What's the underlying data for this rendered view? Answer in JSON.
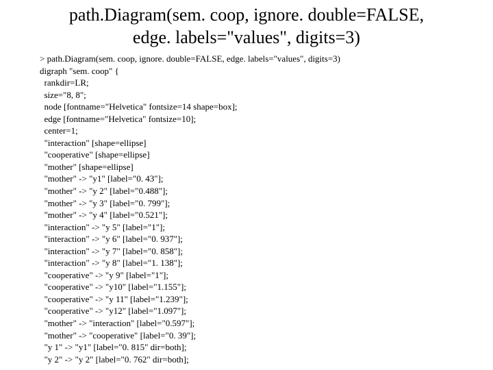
{
  "title_line1": "path.Diagram(sem. coop, ignore. double=FALSE,",
  "title_line2": "edge. labels=\"values\", digits=3)",
  "code_lines": [
    "> path.Diagram(sem. coop, ignore. double=FALSE, edge. labels=\"values\", digits=3)",
    "digraph \"sem. coop\" {",
    "  rankdir=LR;",
    "  size=\"8, 8\";",
    "  node [fontname=\"Helvetica\" fontsize=14 shape=box];",
    "  edge [fontname=\"Helvetica\" fontsize=10];",
    "  center=1;",
    "  \"interaction\" [shape=ellipse]",
    "  \"cooperative\" [shape=ellipse]",
    "  \"mother\" [shape=ellipse]",
    "  \"mother\" -> \"y1\" [label=\"0. 43\"];",
    "  \"mother\" -> \"y 2\" [label=\"0.488\"];",
    "  \"mother\" -> \"y 3\" [label=\"0. 799\"];",
    "  \"mother\" -> \"y 4\" [label=\"0.521\"];",
    "  \"interaction\" -> \"y 5\" [label=\"1\"];",
    "  \"interaction\" -> \"y 6\" [label=\"0. 937\"];",
    "  \"interaction\" -> \"y 7\" [label=\"0. 858\"];",
    "  \"interaction\" -> \"y 8\" [label=\"1. 138\"];",
    "  \"cooperative\" -> \"y 9\" [label=\"1\"];",
    "  \"cooperative\" -> \"y10\" [label=\"1.155\"];",
    "  \"cooperative\" -> \"y 11\" [label=\"1.239\"];",
    "  \"cooperative\" -> \"y12\" [label=\"1.097\"];",
    "  \"mother\" -> \"interaction\" [label=\"0.597\"];",
    "  \"mother\" -> \"cooperative\" [label=\"0. 39\"];",
    "  \"y 1\" -> \"y1\" [label=\"0. 815\" dir=both];",
    "  \"y 2\" -> \"y 2\" [label=\"0. 762\" dir=both];"
  ]
}
